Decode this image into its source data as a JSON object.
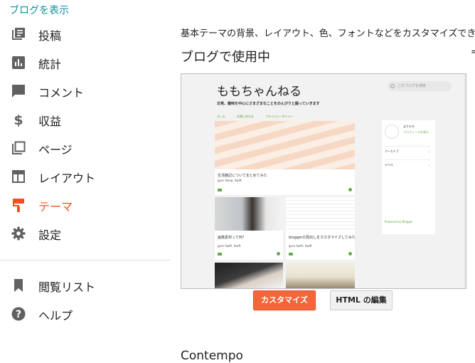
{
  "header": {
    "view_blog": "ブログを表示"
  },
  "nav": {
    "items": [
      {
        "label": "投稿",
        "icon": "posts-icon"
      },
      {
        "label": "統計",
        "icon": "stats-icon"
      },
      {
        "label": "コメント",
        "icon": "comment-icon"
      },
      {
        "label": "収益",
        "icon": "dollar-icon"
      },
      {
        "label": "ページ",
        "icon": "pages-icon"
      },
      {
        "label": "レイアウト",
        "icon": "layout-icon"
      },
      {
        "label": "テーマ",
        "icon": "paint-roller-icon",
        "active": true
      },
      {
        "label": "設定",
        "icon": "gear-icon"
      }
    ],
    "secondary": [
      {
        "label": "閲覧リスト",
        "icon": "bookmark-icon"
      },
      {
        "label": "ヘルプ",
        "icon": "help-icon"
      }
    ]
  },
  "main": {
    "description": "基本テーマの背景、レイアウト、色、フォントなどをカスタマイズでき",
    "current_section": "ブログで使用中",
    "clipped_char": "=",
    "preview": {
      "blog_title": "ももちゃんねる",
      "search_placeholder": "このブログを検索",
      "blog_description": "日常、趣味を中心にさまざまなことをのんびりと綴っていきます",
      "tabs": [
        "ホーム",
        "お問い合わせ",
        "プライバシーポリシー"
      ],
      "posts": [
        {
          "title": "生活雑記についてまとめてみた",
          "meta": "gum Sleep, Swift"
        },
        {
          "title": "画像素材って何？",
          "meta": "gum Swift, Swift"
        },
        {
          "title": "bloggerの見出しをカスタマイズしてみた",
          "meta": "gum Swift, Swift"
        }
      ],
      "sidebar": {
        "name": "まりもち",
        "profile_link": "プロフィールを表示",
        "archive": "アーカイブ",
        "labels": "ラベル",
        "powered": "Powered by Blogger"
      }
    },
    "buttons": {
      "customize": "カスタマイズ",
      "edit_html": "HTML の編集"
    },
    "next_theme": "Contempo"
  },
  "colors": {
    "accent": "#f4511e",
    "link": "#0f8e9b",
    "icon": "#616161"
  }
}
